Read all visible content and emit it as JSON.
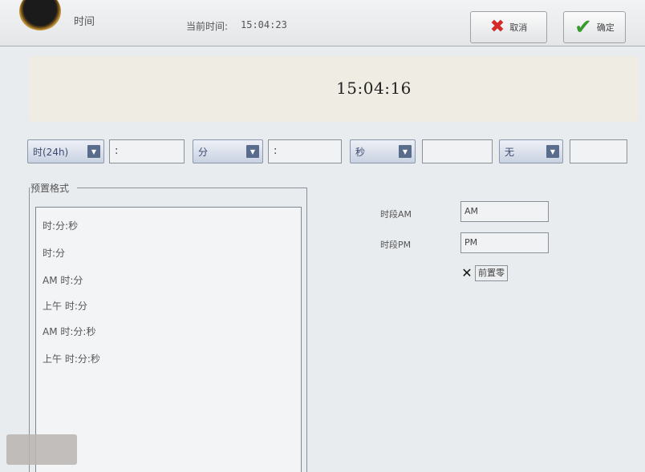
{
  "header": {
    "title": "时间",
    "current_time_label": "当前时间:",
    "current_time_value": "15:04:23",
    "cancel_label": "取消",
    "ok_label": "确定"
  },
  "display": {
    "time": "15:04:16"
  },
  "format_row": {
    "hour_dropdown": "时(24h)",
    "sep1": ":",
    "minute_dropdown": "分",
    "sep2": ":",
    "second_dropdown": "秒",
    "sep3": "",
    "ampm_dropdown": "无",
    "sep4": ""
  },
  "preset": {
    "group_label": "预置格式",
    "items": [
      "时:分:秒",
      "时:分",
      "AM 时:分",
      "上午 时:分",
      "AM 时:分:秒",
      "上午 时:分:秒"
    ]
  },
  "period": {
    "am_label": "时段AM",
    "am_value": "AM",
    "pm_label": "时段PM",
    "pm_value": "PM",
    "leading_zero_label": "前置零",
    "leading_zero_checked": true
  },
  "colors": {
    "cancel_icon": "#d42a2a",
    "ok_icon": "#3a9a2e",
    "display_bg": "#efede3"
  },
  "icons": {
    "cancel": "close-icon",
    "ok": "check-icon",
    "dropdown": "chevron-down-icon"
  }
}
